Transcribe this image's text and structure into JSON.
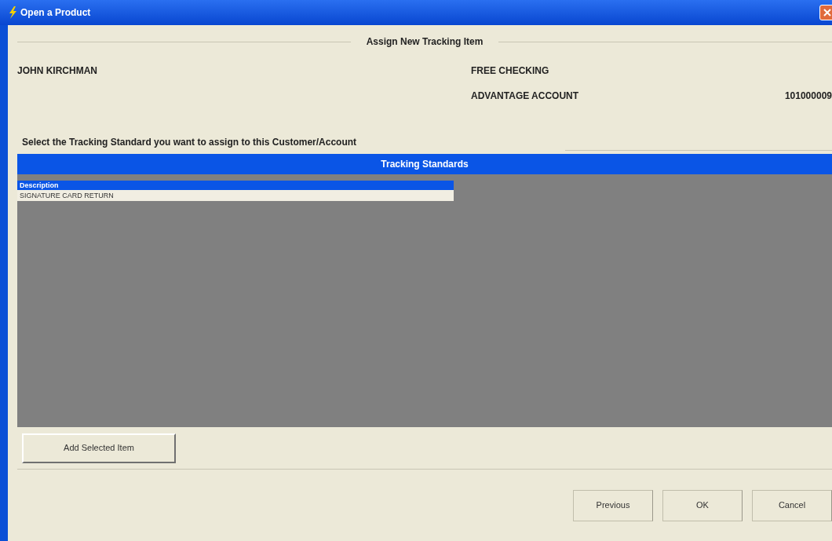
{
  "window": {
    "title": "Open a Product"
  },
  "heading": "Assign New Tracking Item",
  "customer": {
    "name": "JOHN KIRCHMAN",
    "product": "FREE CHECKING",
    "account_type": "ADVANTAGE ACCOUNT",
    "account_number": "101000009"
  },
  "prompt": "Select the Tracking Standard you want to assign to this Customer/Account",
  "panel": {
    "title": "Tracking Standards",
    "columns": [
      "Description"
    ],
    "rows": [
      {
        "cells": [
          "SIGNATURE CARD RETURN"
        ],
        "selected": false
      }
    ]
  },
  "add_button": "Add Selected Item",
  "buttons": [
    "Previous",
    "OK",
    "Cancel"
  ]
}
